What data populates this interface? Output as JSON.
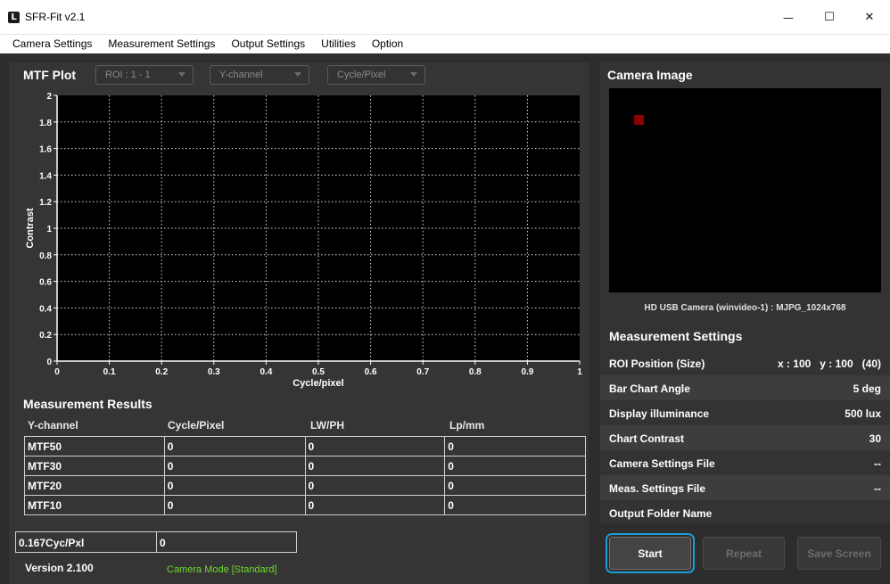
{
  "window": {
    "title": "SFR-Fit v2.1",
    "icon_letter": "L",
    "minimize_glyph": "—",
    "maximize_glyph": "☐",
    "close_glyph": "✕"
  },
  "menu": [
    "Camera Settings",
    "Measurement Settings",
    "Output Settings",
    "Utilities",
    "Option"
  ],
  "mtf_plot": {
    "title": "MTF Plot",
    "roi_select": "ROI : 1 - 1",
    "channel_select": "Y-channel",
    "unit_select": "Cycle/Pixel"
  },
  "chart_data": {
    "type": "line",
    "title": "",
    "xlabel": "Cycle/pixel",
    "ylabel": "Contrast",
    "xlim": [
      0,
      1
    ],
    "ylim": [
      0,
      2
    ],
    "x_ticks": [
      "0",
      "0.1",
      "0.2",
      "0.3",
      "0.4",
      "0.5",
      "0.6",
      "0.7",
      "0.8",
      "0.9",
      "1"
    ],
    "y_ticks": [
      "0",
      "0.2",
      "0.4",
      "0.6",
      "0.8",
      "1",
      "1.2",
      "1.4",
      "1.6",
      "1.8",
      "2"
    ],
    "grid": true,
    "series": []
  },
  "results": {
    "title": "Measurement Results",
    "headers": [
      "Y-channel",
      "Cycle/Pixel",
      "LW/PH",
      "Lp/mm"
    ],
    "rows": [
      [
        "MTF50",
        "0",
        "0",
        "0"
      ],
      [
        "MTF30",
        "0",
        "0",
        "0"
      ],
      [
        "MTF20",
        "0",
        "0",
        "0"
      ],
      [
        "MTF10",
        "0",
        "0",
        "0"
      ]
    ],
    "freq_label": "0.167Cyc/Pxl",
    "freq_value": "0"
  },
  "status": {
    "version": "Version 2.100",
    "camera_mode": "Camera Mode [Standard]"
  },
  "camera": {
    "title": "Camera Image",
    "caption": "HD USB Camera (winvideo-1) : MJPG_1024x768"
  },
  "settings": {
    "title": "Measurement Settings",
    "rows": [
      {
        "label": "ROI Position (Size)",
        "value": "x : 100   y : 100   (40)"
      },
      {
        "label": "Bar Chart Angle",
        "value": "5 deg"
      },
      {
        "label": "Display illuminance",
        "value": "500 lux"
      },
      {
        "label": "Chart Contrast",
        "value": "30"
      },
      {
        "label": "Camera Settings File",
        "value": "--"
      },
      {
        "label": "Meas. Settings File",
        "value": "--"
      },
      {
        "label": "Output Folder Name",
        "value": ""
      }
    ]
  },
  "buttons": {
    "start": "Start",
    "repeat": "Repeat",
    "save_screen": "Save Screen"
  }
}
